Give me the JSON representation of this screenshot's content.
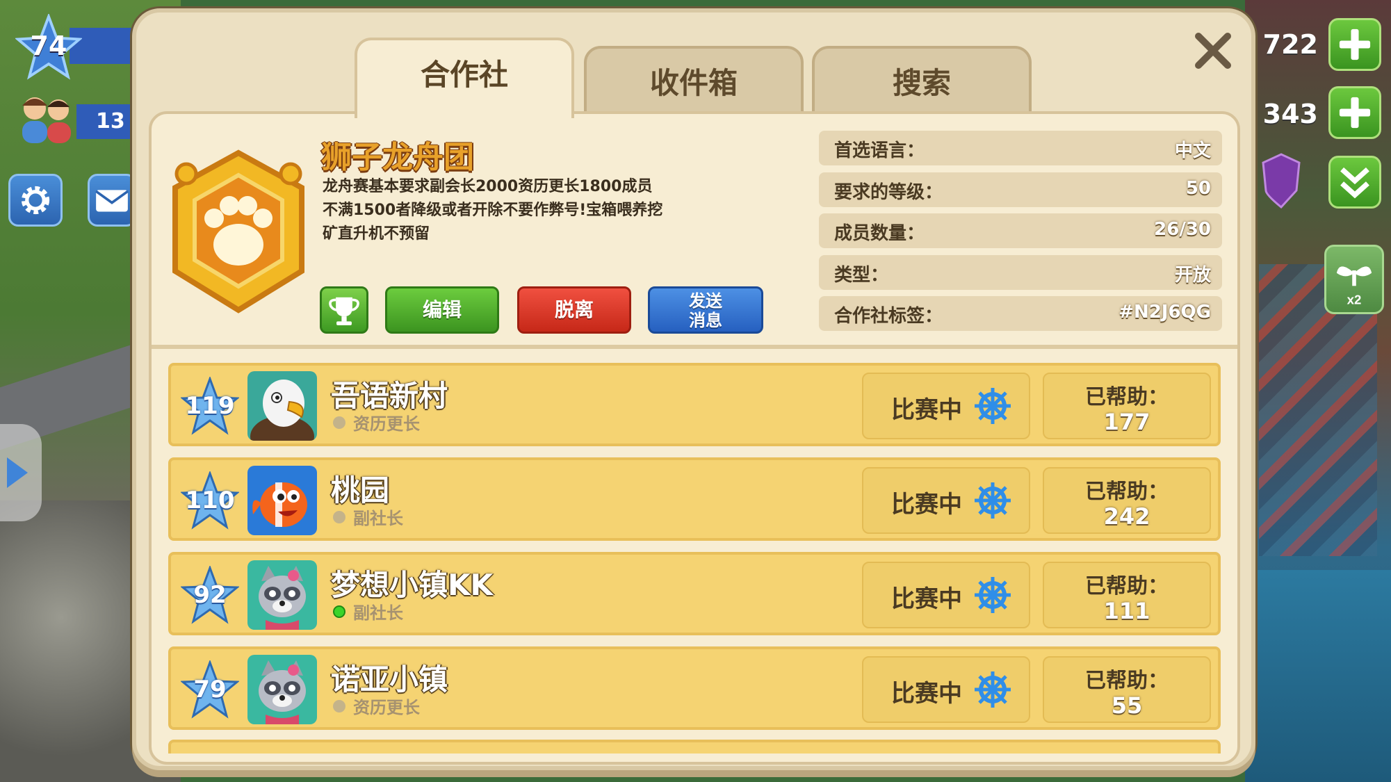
{
  "hud": {
    "player_level": "74",
    "population": "13",
    "counter_top": "722",
    "counter_second": "343",
    "sprout_multiplier": "x2"
  },
  "tabs": [
    {
      "label": "合作社",
      "active": true
    },
    {
      "label": "收件箱",
      "active": false
    },
    {
      "label": "搜索",
      "active": false
    }
  ],
  "club": {
    "name": "狮子龙舟团",
    "description_lines": [
      "龙舟赛基本要求副会长2000资历更长1800成员",
      "不满1500者降级或者开除不要作弊号!宝箱喂养挖",
      "矿直升机不预留"
    ],
    "buttons": {
      "edit": "编辑",
      "leave": "脱离",
      "send_line1": "发送",
      "send_line2": "消息"
    },
    "info": [
      {
        "key": "首选语言：",
        "value": "中文"
      },
      {
        "key": "要求的等级：",
        "value": "50"
      },
      {
        "key": "成员数量：",
        "value": "26/30"
      },
      {
        "key": "类型：",
        "value": "开放"
      },
      {
        "key": "合作社标签：",
        "value": "#N2J6QG"
      }
    ]
  },
  "members": [
    {
      "level": "119",
      "name": "吾语新村",
      "role": "资历更长",
      "online": false,
      "status": "比赛中",
      "helped_label": "已帮助：",
      "helped": "177",
      "avatar": "eagle-avatar"
    },
    {
      "level": "110",
      "name": "桃园",
      "role": "副社长",
      "online": false,
      "status": "比赛中",
      "helped_label": "已帮助：",
      "helped": "242",
      "avatar": "fish-avatar"
    },
    {
      "level": "92",
      "name": "梦想小镇KK",
      "role": "副社长",
      "online": true,
      "status": "比赛中",
      "helped_label": "已帮助：",
      "helped": "111",
      "avatar": "raccoon-avatar"
    },
    {
      "level": "79",
      "name": "诺亚小镇",
      "role": "资历更长",
      "online": false,
      "status": "比赛中",
      "helped_label": "已帮助：",
      "helped": "55",
      "avatar": "raccoon-avatar"
    }
  ],
  "colors": {
    "panel": "#ece0c2",
    "member_row": "#f5d372",
    "club_name": "#e8a12a",
    "edit_button": "#3c9420",
    "leave_button": "#c62818",
    "send_button": "#2660c0"
  }
}
